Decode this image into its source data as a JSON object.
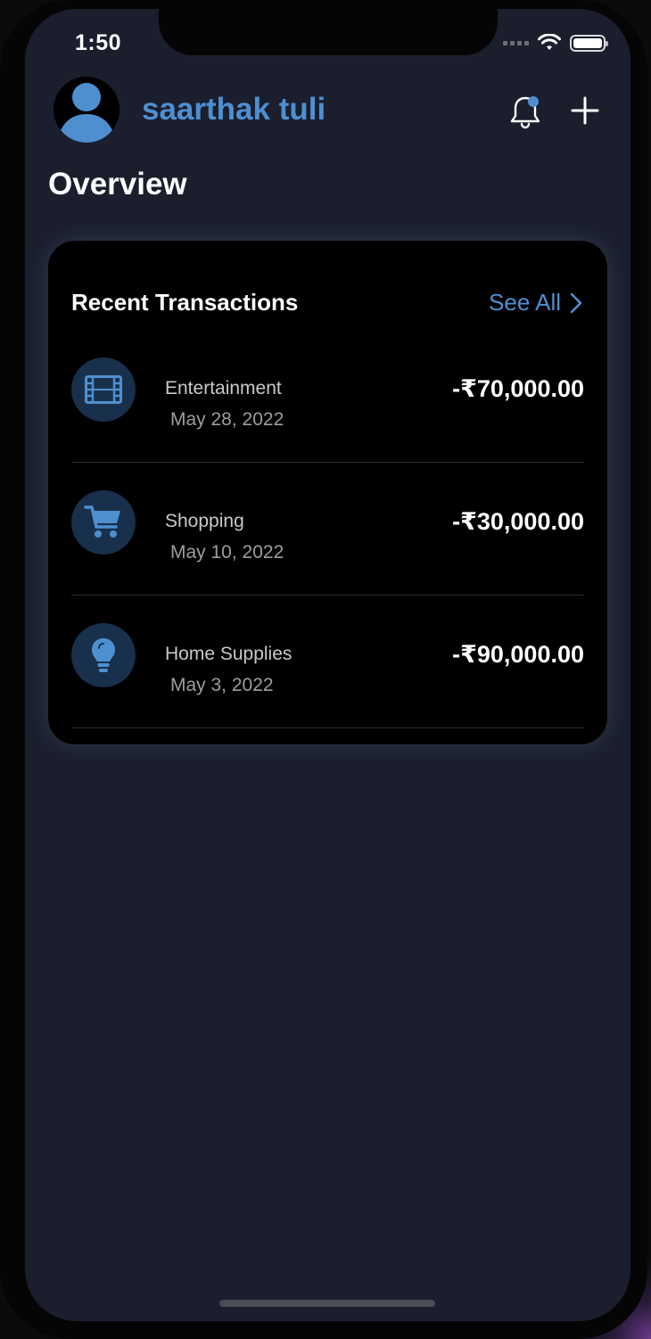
{
  "status_bar": {
    "time": "1:50",
    "icons": [
      "cellular-signal-icon",
      "wifi-icon",
      "battery-icon"
    ],
    "battery_level": 1.0
  },
  "header": {
    "username": "saarthak tuli",
    "avatar_icon": "person-icon",
    "notification_icon": "bell-icon",
    "notification_badge_color": "#4e8fd0",
    "add_icon": "plus-icon"
  },
  "page": {
    "title": "Overview"
  },
  "recent_transactions": {
    "title": "Recent Transactions",
    "see_all_label": "See All",
    "see_all_icon": "chevron-right-icon",
    "items": [
      {
        "icon": "film-icon",
        "name": "Entertainment",
        "date": "May 28, 2022",
        "amount": "-₹70,000.00"
      },
      {
        "icon": "cart-icon",
        "name": "Shopping",
        "date": "May 10, 2022",
        "amount": "-₹30,000.00"
      },
      {
        "icon": "lightbulb-icon",
        "name": "Home Supplies",
        "date": "May 3, 2022",
        "amount": "-₹90,000.00"
      }
    ]
  },
  "colors": {
    "accent": "#4e8fd0",
    "background": "#1a1e2d",
    "card": "#000000",
    "icon_circle": "#19304c"
  }
}
